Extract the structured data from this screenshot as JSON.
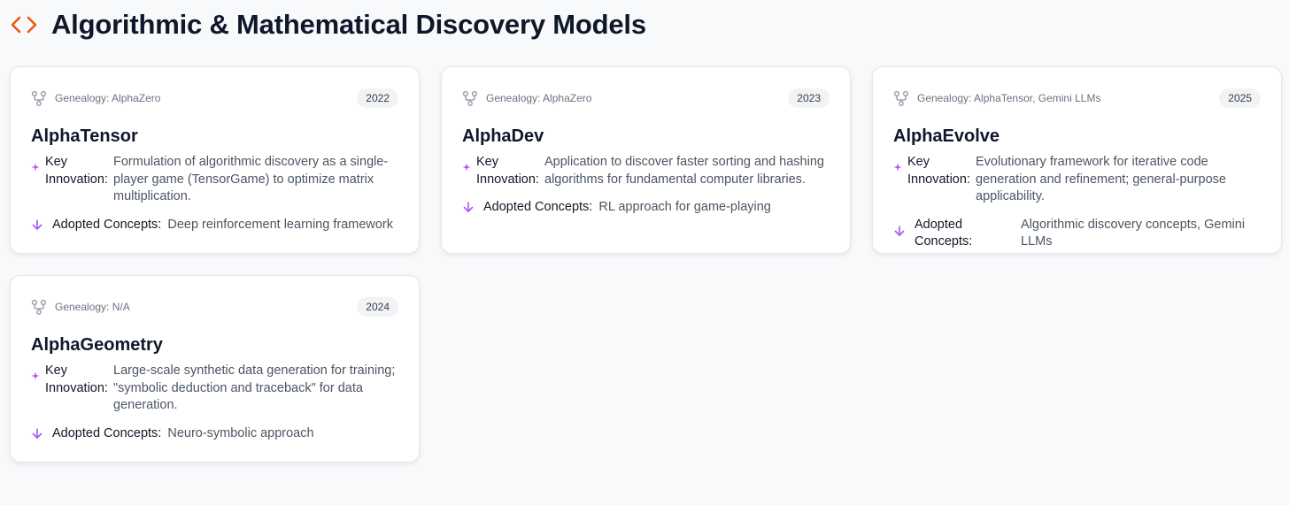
{
  "page": {
    "title": "Algorithmic & Mathematical Discovery Models",
    "title_icon": "code-brackets-icon",
    "accent_color": "#ea580c",
    "concept_color": "#a855f7"
  },
  "cards": [
    {
      "genealogy": "Genealogy: AlphaZero",
      "year": "2022",
      "name": "AlphaTensor",
      "key_label": "Key Innovation:",
      "key_text": "Formulation of algorithmic discovery as a single-player game (TensorGame) to optimize matrix multiplication.",
      "adopted_label": "Adopted Concepts:",
      "adopted_text": "Deep reinforcement learning framework"
    },
    {
      "genealogy": "Genealogy: AlphaZero",
      "year": "2023",
      "name": "AlphaDev",
      "key_label": "Key Innovation:",
      "key_text": "Application to discover faster sorting and hashing algorithms for fundamental computer libraries.",
      "adopted_label": "Adopted Concepts:",
      "adopted_text": "RL approach for game-playing"
    },
    {
      "genealogy": "Genealogy: AlphaTensor, Gemini LLMs",
      "year": "2025",
      "name": "AlphaEvolve",
      "key_label": "Key Innovation:",
      "key_text": "Evolutionary framework for iterative code generation and refinement; general-purpose applicability.",
      "adopted_label": "Adopted Concepts:",
      "adopted_text": "Algorithmic discovery concepts, Gemini LLMs"
    },
    {
      "genealogy": "Genealogy: N/A",
      "year": "2024",
      "name": "AlphaGeometry",
      "key_label": "Key Innovation:",
      "key_text": "Large-scale synthetic data generation for training; \"symbolic deduction and traceback\" for data generation.",
      "adopted_label": "Adopted Concepts:",
      "adopted_text": "Neuro-symbolic approach"
    }
  ]
}
